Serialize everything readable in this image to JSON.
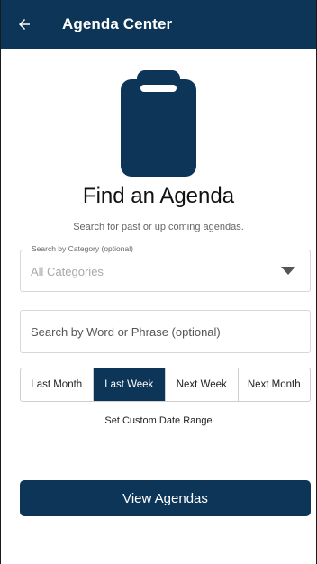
{
  "header": {
    "back_icon": "arrow-left-icon",
    "title": "Agenda Center"
  },
  "hero": {
    "icon": "clipboard-icon",
    "heading": "Find an Agenda",
    "subheading": "Search for past or up coming agendas."
  },
  "category": {
    "label": "Search by Category (optional)",
    "value": "All Categories",
    "caret_icon": "caret-down-icon"
  },
  "search": {
    "placeholder": "Search by Word or Phrase (optional)",
    "value": ""
  },
  "ranges": [
    {
      "label": "Last Month",
      "active": false
    },
    {
      "label": "Last Week",
      "active": true
    },
    {
      "label": "Next Week",
      "active": false
    },
    {
      "label": "Next Month",
      "active": false
    }
  ],
  "custom_range_label": "Set Custom Date Range",
  "view_button_label": "View Agendas",
  "colors": {
    "primary": "#0d3558",
    "background": "#ffffff"
  }
}
